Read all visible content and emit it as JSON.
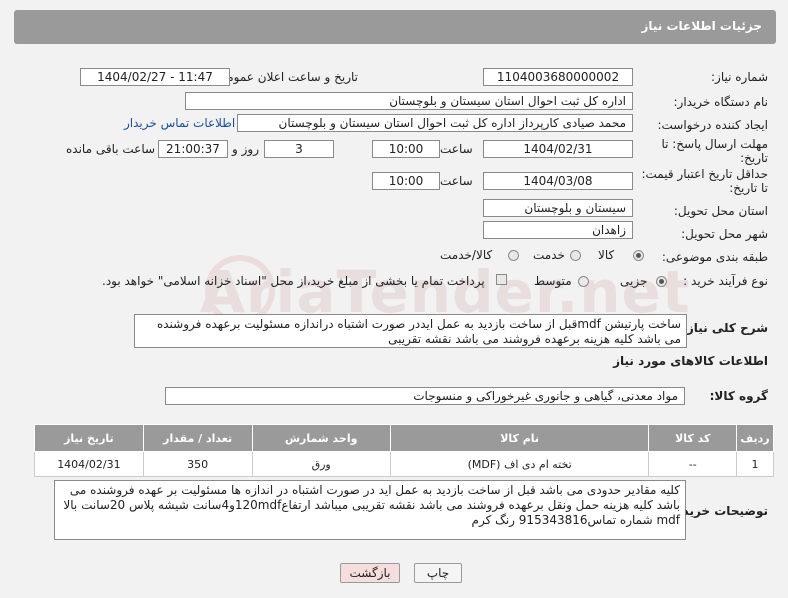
{
  "header": {
    "title": "جزئیات اطلاعات نیاز"
  },
  "watermark": "AriaTender.net",
  "fields": {
    "need_number_label": "شماره نیاز:",
    "need_number": "1104003680000002",
    "announce_label": "تاریخ و ساعت اعلان عمومی:",
    "announce_value": "1404/02/27 - 11:47",
    "buyer_org_label": "نام دستگاه خریدار:",
    "buyer_org": "اداره کل ثبت احوال استان سیستان و بلوچستان",
    "creator_label": "ایجاد کننده درخواست:",
    "creator": "محمد صیادی کارپرداز اداره کل ثبت احوال استان سیستان و بلوچستان",
    "contact_link": "اطلاعات تماس خریدار",
    "deadline_label_1": "مهلت ارسال پاسخ: تا",
    "deadline_label_2": "تاریخ:",
    "deadline_date": "1404/02/31",
    "hour_label": "ساعت",
    "deadline_time": "10:00",
    "day_and_label": "روز و",
    "deadline_days": "3",
    "remaining_time": "21:00:37",
    "remaining_label": "ساعت باقی مانده",
    "validity_label_1": "حداقل تاریخ اعتبار قیمت:",
    "validity_label_2": "تا تاریخ:",
    "validity_date": "1404/03/08",
    "validity_time": "10:00",
    "province_label": "استان محل تحویل:",
    "province": "سیستان و بلوچستان",
    "city_label": "شهر محل تحویل:",
    "city": "زاهدان",
    "category_label": "طبقه بندی موضوعی:",
    "cat_goods": "کالا",
    "cat_service": "خدمت",
    "cat_goods_service": "کالا/خدمت",
    "process_label": "نوع فرآیند خرید :",
    "proc_partial": "جزیی",
    "proc_medium": "متوسط",
    "payment_note": "پرداخت تمام یا بخشی از مبلغ خرید،از محل \"اسناد خزانه اسلامی\" خواهد بود.",
    "description_label": "شرح کلی نیاز:",
    "description": "ساخت پارتیشن mdfقبل از ساخت بازدید به عمل ایددر صورت اشتباه دراندازه مسئولیت برعهده فروشنده می باشد کلیه هزینه برعهده فروشند می باشد نقشه تقریبی"
  },
  "goods": {
    "section_title": "اطلاعات کالاهای مورد نیاز",
    "group_label": "گروه کالا:",
    "group_value": "مواد معدنی، گیاهی و جانوری غیرخوراکی و منسوجات",
    "columns": [
      "ردیف",
      "کد کالا",
      "نام کالا",
      "واحد شمارش",
      "تعداد / مقدار",
      "تاریخ نیاز"
    ],
    "rows": [
      [
        "1",
        "--",
        "تخته ام دی اف (MDF)",
        "ورق",
        "350",
        "1404/02/31"
      ]
    ]
  },
  "buyer_notes": {
    "label": "توضیحات خریدار:",
    "text": "کلیه مقادیر حدودی می باشد قبل از ساخت بازدید به عمل اید در صورت اشتباه در اندازه ها مسئولیت بر عهده فروشنده می باشد کلیه هزینه حمل ونقل برعهده فروشند می باشد نقشه تقریبی میباشد ارتفاع120mdfو4سانت شیشه پلاس 20سانت بالا mdf شماره تماس915343816 رنگ کرم"
  },
  "buttons": {
    "print": "چاپ",
    "back": "بازگشت"
  }
}
